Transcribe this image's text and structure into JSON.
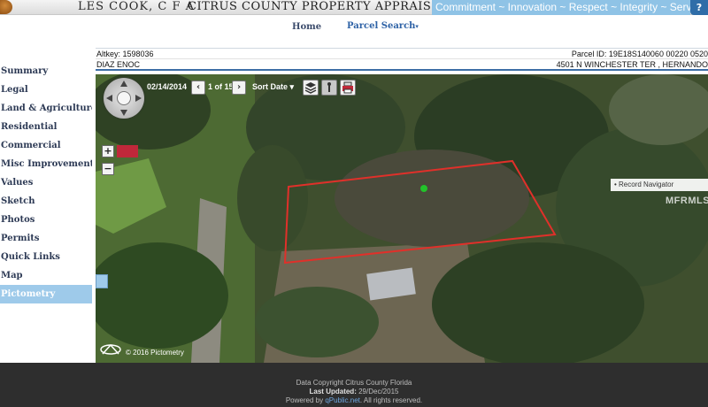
{
  "banner": {
    "appraiser_name": "LES COOK, C F A",
    "office": "CITRUS COUNTY PROPERTY APPRAISER",
    "tagline": "Commitment ~ Innovation ~ Respect ~ Integrity ~ Service",
    "help_label": "?"
  },
  "topnav": {
    "home_label": "Home",
    "parcel_search_label": "Parcel Search",
    "caret": "▾"
  },
  "parcel": {
    "altkey": "Altkey: 1598036",
    "parcel_id": "Parcel ID: 19E18S140060 00220 0520",
    "owner": "DIAZ ENOC",
    "address": "4501 N WINCHESTER TER , HERNANDO"
  },
  "sidebar": {
    "items": [
      {
        "label": "Summary"
      },
      {
        "label": "Legal"
      },
      {
        "label": "Land & Agriculture"
      },
      {
        "label": "Residential"
      },
      {
        "label": "Commercial"
      },
      {
        "label": "Misc Improvements"
      },
      {
        "label": "Values"
      },
      {
        "label": "Sketch"
      },
      {
        "label": "Photos"
      },
      {
        "label": "Permits"
      },
      {
        "label": "Quick Links"
      },
      {
        "label": "Map"
      },
      {
        "label": "Pictometry",
        "active": true
      }
    ]
  },
  "viewer": {
    "date": "02/14/2014",
    "image_count": "1 of 15",
    "sort_label": "Sort Date ▾",
    "prev_label": "‹",
    "next_label": "›",
    "zoom_in": "+",
    "zoom_out": "−",
    "record_navigator": "• Record Navigator",
    "watermark": "MFRMLS",
    "copyright": "© 2016 Pictometry",
    "parcel_outline_color": "#e0302a",
    "marker_color": "#22c32a"
  },
  "footer": {
    "line1": "Data Copyright Citrus County Florida",
    "last_updated_label": "Last Updated:",
    "last_updated_value": "29/Dec/2015",
    "powered_prefix": "Powered by",
    "powered_link": "qPublic.net",
    "powered_suffix": ". All rights reserved."
  }
}
